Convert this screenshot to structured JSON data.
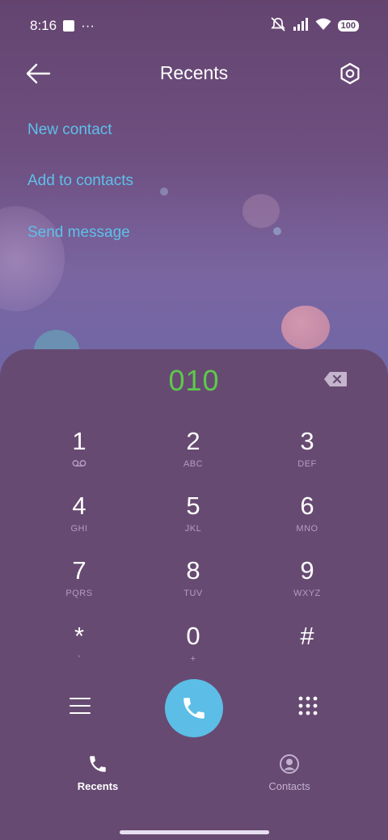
{
  "status_bar": {
    "time": "8:16",
    "dots": "···",
    "battery": "100"
  },
  "header": {
    "title": "Recents"
  },
  "actions": {
    "new_contact": "New contact",
    "add_to_contacts": "Add to contacts",
    "send_message": "Send message"
  },
  "dialer": {
    "number": "010",
    "keys": [
      {
        "digit": "1",
        "sub": ""
      },
      {
        "digit": "2",
        "sub": "ABC"
      },
      {
        "digit": "3",
        "sub": "DEF"
      },
      {
        "digit": "4",
        "sub": "GHI"
      },
      {
        "digit": "5",
        "sub": "JKL"
      },
      {
        "digit": "6",
        "sub": "MNO"
      },
      {
        "digit": "7",
        "sub": "PQRS"
      },
      {
        "digit": "8",
        "sub": "TUV"
      },
      {
        "digit": "9",
        "sub": "WXYZ"
      },
      {
        "digit": "*",
        "sub": "'"
      },
      {
        "digit": "0",
        "sub": "+"
      },
      {
        "digit": "#",
        "sub": ""
      }
    ]
  },
  "bottom_nav": {
    "recents": "Recents",
    "contacts": "Contacts"
  },
  "colors": {
    "background": "#674a72",
    "accent_blue": "#5ec0ea",
    "number_green": "#5dc94c",
    "call_button": "#5cbee6"
  },
  "icons": [
    "back-arrow-icon",
    "settings-icon",
    "backspace-icon",
    "voicemail-icon",
    "menu-icon",
    "phone-icon",
    "dialpad-grid-icon",
    "person-icon",
    "mute-icon",
    "signal-icon",
    "wifi-icon"
  ]
}
